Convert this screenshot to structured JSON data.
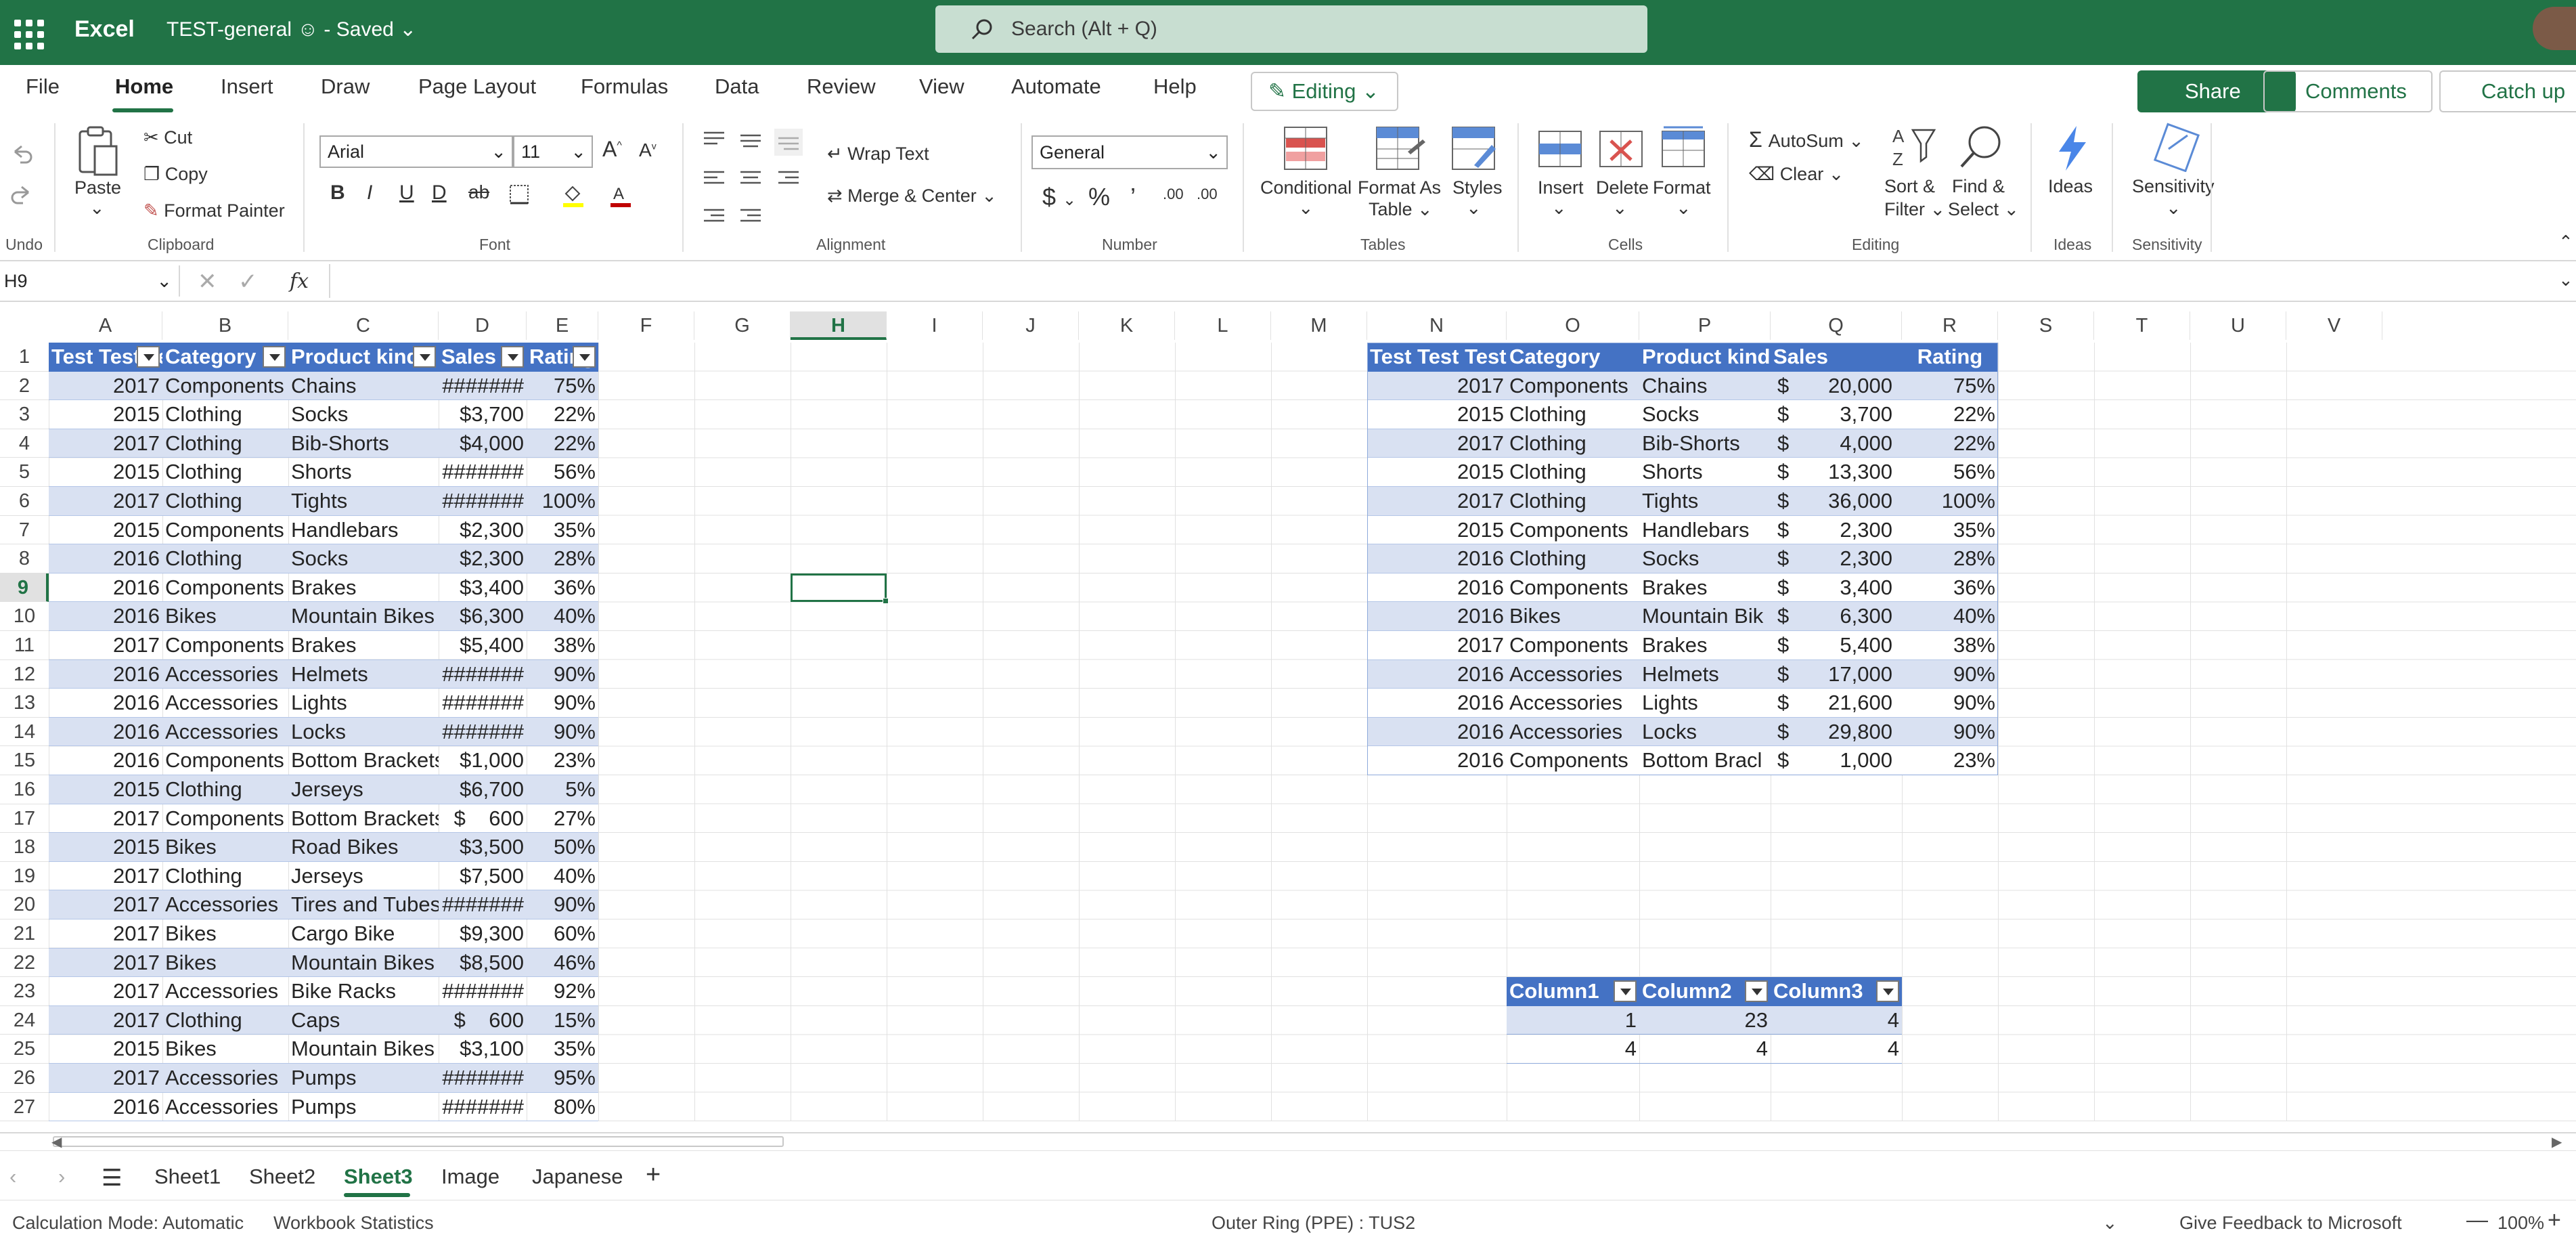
{
  "titlebar": {
    "app": "Excel",
    "doc_name": "TEST-general",
    "saved": "- Saved",
    "search_placeholder": "Search (Alt + Q)"
  },
  "tabs": [
    "File",
    "Home",
    "Insert",
    "Draw",
    "Page Layout",
    "Formulas",
    "Data",
    "Review",
    "View",
    "Automate",
    "Help"
  ],
  "right_buttons": {
    "editing": "Editing",
    "share": "Share",
    "comments": "Comments",
    "catchup": "Catch up"
  },
  "ribbon": {
    "undo_label": "Undo",
    "clipboard": {
      "paste": "Paste",
      "cut": "Cut",
      "copy": "Copy",
      "format_painter": "Format Painter",
      "label": "Clipboard"
    },
    "font": {
      "name": "Arial",
      "size": "11",
      "label": "Font"
    },
    "alignment": {
      "wrap": "Wrap Text",
      "merge": "Merge & Center",
      "label": "Alignment"
    },
    "number": {
      "format": "General",
      "label": "Number"
    },
    "tables": {
      "conditional": "Conditional",
      "format_as_table": "Format As",
      "format_as_table2": "Table",
      "styles": "Styles",
      "label": "Tables"
    },
    "cells": {
      "insert": "Insert",
      "delete": "Delete",
      "format": "Format",
      "label": "Cells"
    },
    "editing": {
      "autosum": "AutoSum",
      "clear": "Clear",
      "sort": "Sort &",
      "sort2": "Filter",
      "find": "Find &",
      "find2": "Select",
      "label": "Editing"
    },
    "ideas": {
      "btn": "Ideas",
      "label": "Ideas"
    },
    "sensitivity": {
      "btn": "Sensitivity",
      "label": "Sensitivity"
    }
  },
  "formula_bar": {
    "name_box": "H9",
    "fx": "fx",
    "content": ""
  },
  "columns": [
    "A",
    "B",
    "C",
    "D",
    "E",
    "F",
    "G",
    "H",
    "I",
    "J",
    "K",
    "L",
    "M",
    "N",
    "O",
    "P",
    "Q",
    "R",
    "S",
    "T",
    "U",
    "V"
  ],
  "rows": [
    "1",
    "2",
    "3",
    "4",
    "5",
    "6",
    "7",
    "8",
    "9",
    "10",
    "11",
    "12",
    "13",
    "14",
    "15",
    "16",
    "17",
    "18",
    "19",
    "20",
    "21",
    "22",
    "23",
    "24",
    "25",
    "26",
    "27"
  ],
  "table1": {
    "headers": [
      "Test Test Test",
      "Category",
      "Product kind",
      "Sales",
      "Rating"
    ],
    "rows": [
      [
        "2017",
        "Components",
        "Chains",
        "#######",
        "75%"
      ],
      [
        "2015",
        "Clothing",
        "Socks",
        "$3,700",
        "22%"
      ],
      [
        "2017",
        "Clothing",
        "Bib-Shorts",
        "$4,000",
        "22%"
      ],
      [
        "2015",
        "Clothing",
        "Shorts",
        "#######",
        "56%"
      ],
      [
        "2017",
        "Clothing",
        "Tights",
        "#######",
        "100%"
      ],
      [
        "2015",
        "Components",
        "Handlebars",
        "$2,300",
        "35%"
      ],
      [
        "2016",
        "Clothing",
        "Socks",
        "$2,300",
        "28%"
      ],
      [
        "2016",
        "Components",
        "Brakes",
        "$3,400",
        "36%"
      ],
      [
        "2016",
        "Bikes",
        "Mountain Bikes",
        "$6,300",
        "40%"
      ],
      [
        "2017",
        "Components",
        "Brakes",
        "$5,400",
        "38%"
      ],
      [
        "2016",
        "Accessories",
        "Helmets",
        "#######",
        "90%"
      ],
      [
        "2016",
        "Accessories",
        "Lights",
        "#######",
        "90%"
      ],
      [
        "2016",
        "Accessories",
        "Locks",
        "#######",
        "90%"
      ],
      [
        "2016",
        "Components",
        "Bottom Brackets",
        "$1,000",
        "23%"
      ],
      [
        "2015",
        "Clothing",
        "Jerseys",
        "$6,700",
        "5%"
      ],
      [
        "2017",
        "Components",
        "Bottom Brackets",
        "$    600",
        "27%"
      ],
      [
        "2015",
        "Bikes",
        "Road Bikes",
        "$3,500",
        "50%"
      ],
      [
        "2017",
        "Clothing",
        "Jerseys",
        "$7,500",
        "40%"
      ],
      [
        "2017",
        "Accessories",
        "Tires and Tubes",
        "#######",
        "90%"
      ],
      [
        "2017",
        "Bikes",
        "Cargo Bike",
        "$9,300",
        "60%"
      ],
      [
        "2017",
        "Bikes",
        "Mountain Bikes",
        "$8,500",
        "46%"
      ],
      [
        "2017",
        "Accessories",
        "Bike Racks",
        "#######",
        "92%"
      ],
      [
        "2017",
        "Clothing",
        "Caps",
        "$    600",
        "15%"
      ],
      [
        "2015",
        "Bikes",
        "Mountain Bikes",
        "$3,100",
        "35%"
      ],
      [
        "2017",
        "Accessories",
        "Pumps",
        "#######",
        "95%"
      ],
      [
        "2016",
        "Accessories",
        "Pumps",
        "#######",
        "80%"
      ]
    ]
  },
  "table2": {
    "headers": [
      "Test Test Test",
      "Category",
      "Product kind",
      "Sales",
      "Rating"
    ],
    "rows": [
      [
        "2017",
        "Components",
        "Chains",
        "$",
        "20,000",
        "75%"
      ],
      [
        "2015",
        "Clothing",
        "Socks",
        "$",
        "3,700",
        "22%"
      ],
      [
        "2017",
        "Clothing",
        "Bib-Shorts",
        "$",
        "4,000",
        "22%"
      ],
      [
        "2015",
        "Clothing",
        "Shorts",
        "$",
        "13,300",
        "56%"
      ],
      [
        "2017",
        "Clothing",
        "Tights",
        "$",
        "36,000",
        "100%"
      ],
      [
        "2015",
        "Components",
        "Handlebars",
        "$",
        "2,300",
        "35%"
      ],
      [
        "2016",
        "Clothing",
        "Socks",
        "$",
        "2,300",
        "28%"
      ],
      [
        "2016",
        "Components",
        "Brakes",
        "$",
        "3,400",
        "36%"
      ],
      [
        "2016",
        "Bikes",
        "Mountain Bik",
        "$",
        "6,300",
        "40%"
      ],
      [
        "2017",
        "Components",
        "Brakes",
        "$",
        "5,400",
        "38%"
      ],
      [
        "2016",
        "Accessories",
        "Helmets",
        "$",
        "17,000",
        "90%"
      ],
      [
        "2016",
        "Accessories",
        "Lights",
        "$",
        "21,600",
        "90%"
      ],
      [
        "2016",
        "Accessories",
        "Locks",
        "$",
        "29,800",
        "90%"
      ],
      [
        "2016",
        "Components",
        "Bottom Bracl",
        "$",
        "1,000",
        "23%"
      ]
    ]
  },
  "table3": {
    "headers": [
      "Column1",
      "Column2",
      "Column3"
    ],
    "rows": [
      [
        "1",
        "23",
        "4"
      ],
      [
        "4",
        "4",
        "4"
      ]
    ]
  },
  "sheets": [
    "Sheet1",
    "Sheet2",
    "Sheet3",
    "Image",
    "Japanese"
  ],
  "active_sheet": "Sheet3",
  "status": {
    "calc_mode": "Calculation Mode: Automatic",
    "workbook_stats": "Workbook Statistics",
    "ring": "Outer Ring (PPE) : TUS2",
    "feedback": "Give Feedback to Microsoft",
    "zoom": "100%"
  },
  "colors": {
    "brand": "#217346",
    "table_header": "#4472c4",
    "band": "#d9e1f2"
  }
}
